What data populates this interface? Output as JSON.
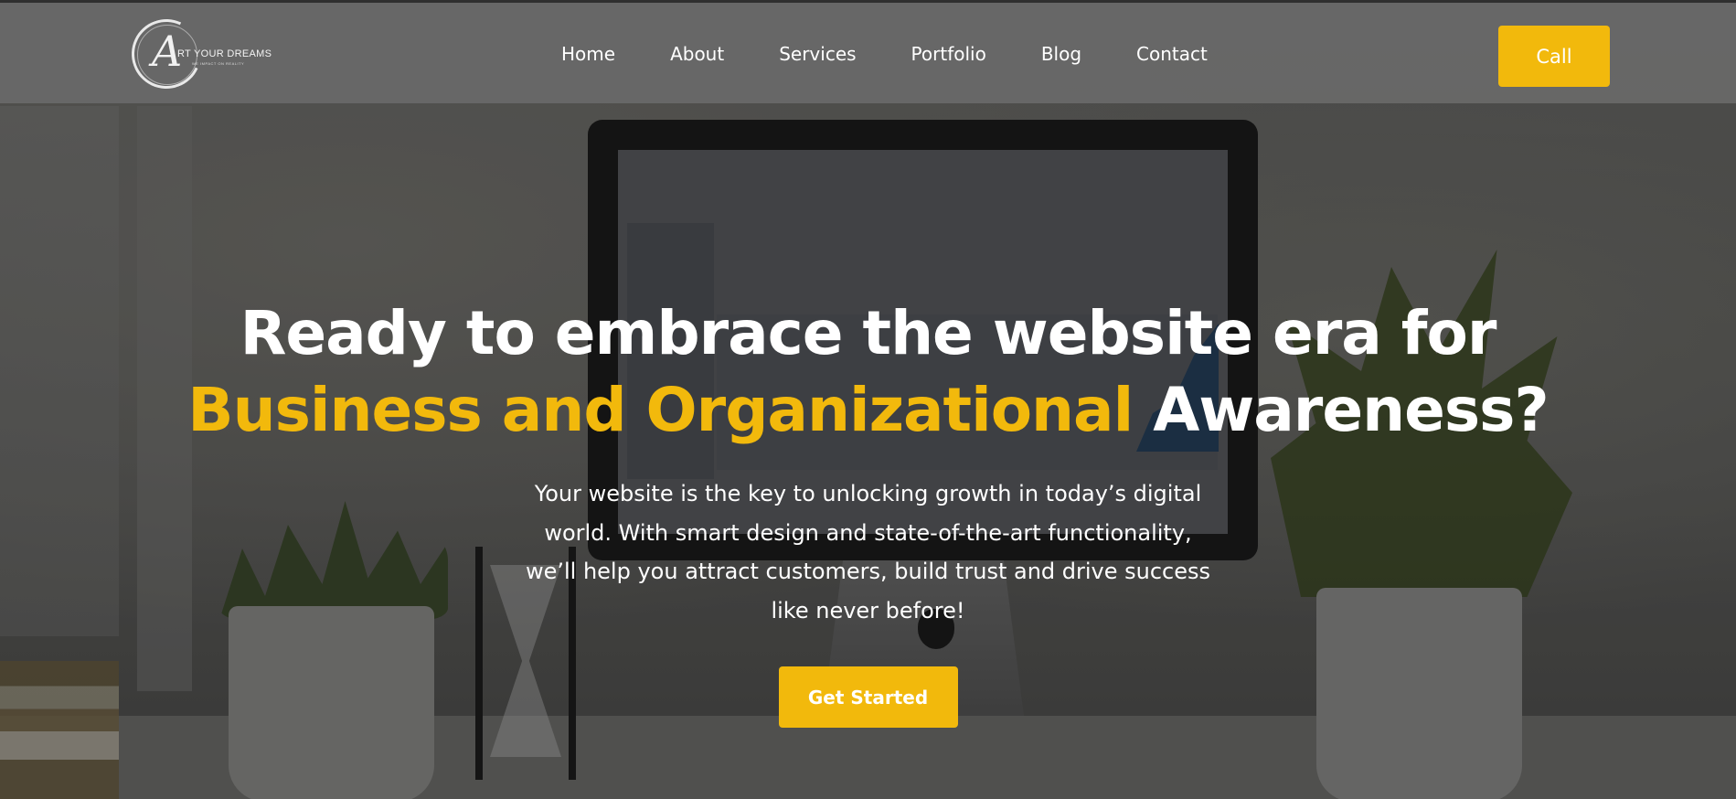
{
  "brand": {
    "monogram": "A",
    "name": "RT YOUR DREAMS",
    "tagline": "WE IMPACT ON REALITY"
  },
  "nav": {
    "items": [
      {
        "label": "Home"
      },
      {
        "label": "About"
      },
      {
        "label": "Services"
      },
      {
        "label": "Portfolio"
      },
      {
        "label": "Blog"
      },
      {
        "label": "Contact"
      }
    ],
    "call_label": "Call"
  },
  "hero": {
    "title_line1": "Ready to embrace the website era for",
    "title_accent": "Business and Organizational",
    "title_end": "Awareness?",
    "description": "Your website is the key to unlocking growth in today’s digital world. With smart design and state-of-the-art functionality, we’ll help you attract customers, build trust and drive success like never before!",
    "cta_label": "Get Started"
  },
  "colors": {
    "accent": "#f2b90c",
    "nav_bg": "#696969",
    "text": "#ffffff"
  }
}
